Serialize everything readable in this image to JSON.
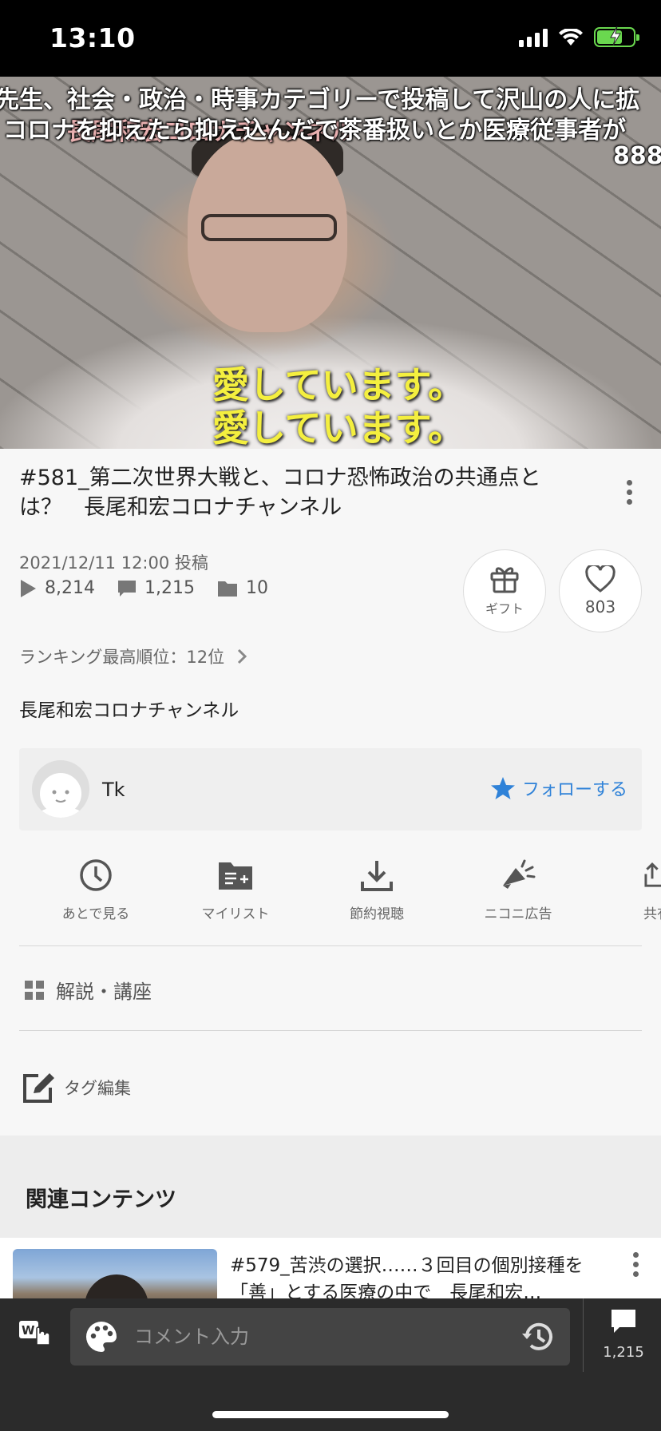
{
  "status_bar": {
    "time": "13:10"
  },
  "video": {
    "danmaku": [
      "先生、社会・政治・時事カテゴリーで投稿して沢山の人に拡",
      "コロナを抑えたら抑え込んだで茶番扱いとか医療従事者が",
      "888"
    ],
    "overlay_text": "長尾和宏コロナチャンネル",
    "subtitles": [
      "愛しています。",
      "愛しています。"
    ]
  },
  "title": "#581_第二次世界大戦と、コロナ恐怖政治の共通点とは？　長尾和宏コロナチャンネル",
  "meta": {
    "posted": "2021/12/11 12:00 投稿",
    "views": "8,214",
    "comments": "1,215",
    "mylists": "10"
  },
  "gift": {
    "label": "ギフト"
  },
  "like": {
    "count": "803"
  },
  "ranking": {
    "text": "ランキング最高順位：12位"
  },
  "channel": {
    "name": "長尾和宏コロナチャンネル"
  },
  "uploader": {
    "name": "Tk",
    "follow_label": "フォローする"
  },
  "actions": [
    {
      "label": "あとで見る",
      "icon": "clock-icon"
    },
    {
      "label": "マイリスト",
      "icon": "mylist-add-icon"
    },
    {
      "label": "節約視聴",
      "icon": "download-icon"
    },
    {
      "label": "ニコニ広告",
      "icon": "megaphone-icon"
    },
    {
      "label": "共有",
      "icon": "share-icon"
    }
  ],
  "category": {
    "label": "解説・講座"
  },
  "tag_edit": {
    "label": "タグ編集"
  },
  "related": {
    "heading": "関連コンテンツ",
    "items": [
      {
        "title": "#579_苦渋の選択……３回目の個別接種を「善」とする医療の中で　長尾和宏…"
      }
    ]
  },
  "comment_bar": {
    "placeholder": "コメント入力",
    "count": "1,215"
  },
  "colors": {
    "accent_blue": "#2f82d8",
    "subtitle_yellow": "#f4ef3f",
    "battery_green": "#6ad84f",
    "bottom_bar": "#2b2b2b"
  }
}
